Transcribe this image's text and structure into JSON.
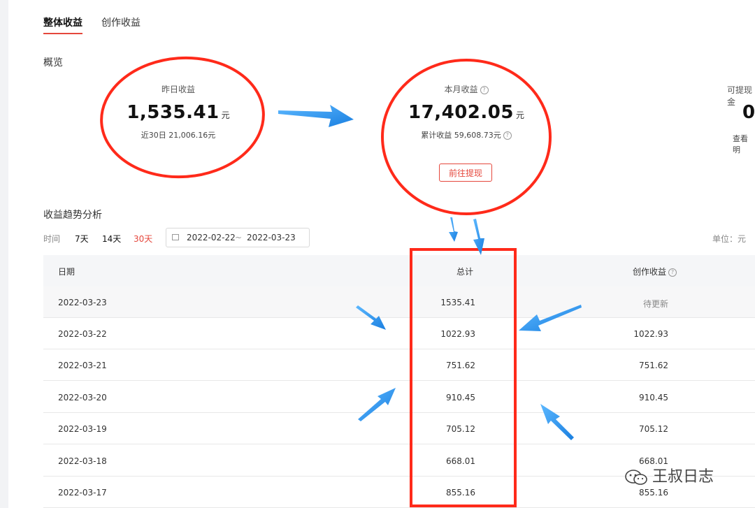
{
  "tabs": [
    {
      "label": "整体收益",
      "active": true
    },
    {
      "label": "创作收益",
      "active": false
    }
  ],
  "overview": {
    "title": "概览",
    "yesterday": {
      "label": "昨日收益",
      "value": "1,535.41",
      "unit": "元",
      "sub_label": "近30日",
      "sub_value": "21,006.16元"
    },
    "month": {
      "label": "本月收益",
      "value": "17,402.05",
      "unit": "元",
      "sub_label": "累计收益",
      "sub_value": "59,608.73元",
      "button": "前往提现"
    },
    "withdrawable": {
      "label": "可提现金",
      "value": "0",
      "link": "查看明"
    }
  },
  "trend": {
    "title": "收益趋势分析",
    "filter_label": "时间",
    "filters": [
      "7天",
      "14天",
      "30天"
    ],
    "active_filter": "30天",
    "date_start": "2022-02-22",
    "date_sep": "~",
    "date_end": "2022-03-23",
    "unit_label": "单位：元"
  },
  "table": {
    "columns": [
      "日期",
      "总计",
      "创作收益"
    ],
    "rows": [
      {
        "date": "2022-03-23",
        "total": "1535.41",
        "creative": "待更新"
      },
      {
        "date": "2022-03-22",
        "total": "1022.93",
        "creative": "1022.93"
      },
      {
        "date": "2022-03-21",
        "total": "751.62",
        "creative": "751.62"
      },
      {
        "date": "2022-03-20",
        "total": "910.45",
        "creative": "910.45"
      },
      {
        "date": "2022-03-19",
        "total": "705.12",
        "creative": "705.12"
      },
      {
        "date": "2022-03-18",
        "total": "668.01",
        "creative": "668.01"
      },
      {
        "date": "2022-03-17",
        "total": "855.16",
        "creative": "855.16"
      }
    ]
  },
  "watermark": {
    "text": "王叔日志",
    "icon": "wechat-icon"
  },
  "colors": {
    "accent": "#e5473c",
    "annotation_red": "#ff2a1a",
    "annotation_blue": "#2196f3"
  }
}
